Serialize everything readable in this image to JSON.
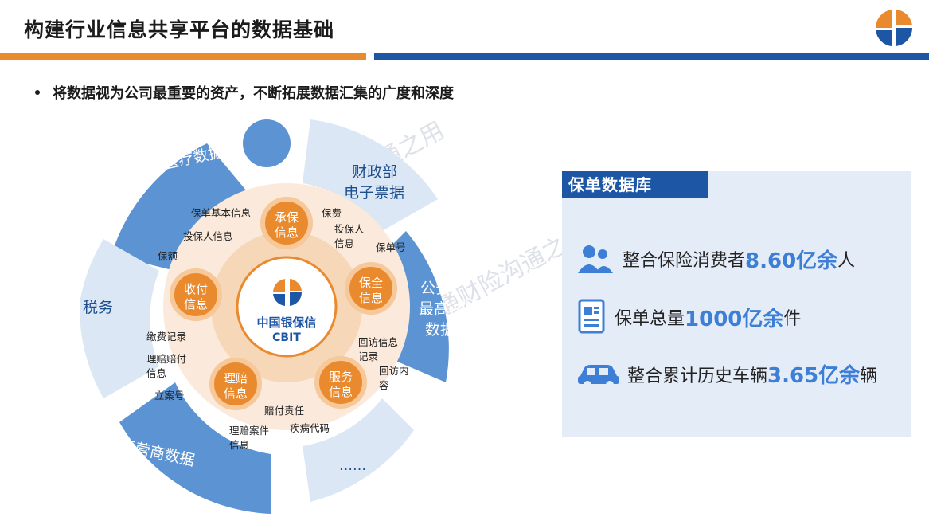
{
  "header": {
    "title": "构建行业信息共享平台的数据基础"
  },
  "bullet": {
    "text": "将数据视为公司最重要的资产，不断拓展数据汇集的广度和深度"
  },
  "center": {
    "logo_cn": "中国银保信",
    "logo_en": "CBIT"
  },
  "outer_ring": {
    "medical": "外部医疗数据",
    "finance_line1": "财政部",
    "finance_line2": "电子票据",
    "police_line1": "公安、",
    "police_line2": "最高法",
    "police_line3": "数据",
    "more": "……",
    "telecom": "运营商数据",
    "tax": "税务"
  },
  "nodes": {
    "underwriting": [
      "承保",
      "信息"
    ],
    "preservation": [
      "保全",
      "信息"
    ],
    "service": [
      "服务",
      "信息"
    ],
    "claims": [
      "理赔",
      "信息"
    ],
    "collection": [
      "收付",
      "信息"
    ]
  },
  "labels": {
    "policy_basic": "保单基本信息",
    "insured_info": "投保人信息",
    "premium": "保费",
    "policyholder_info_1": "投保人",
    "policyholder_info_2": "信息",
    "policy_no": "保单号",
    "amount": "保额",
    "payment_record": "缴费记录",
    "claim_payment_1": "理赔赔付",
    "claim_payment_2": "信息",
    "case_no": "立案号",
    "visit_record_1": "回访信息",
    "visit_record_2": "记录",
    "visit_content_1": "回访内",
    "visit_content_2": "容",
    "liability": "赔付责任",
    "disease_code": "疾病代码",
    "claim_case_1": "理赔案件",
    "claim_case_2": "信息"
  },
  "database": {
    "title": "保单数据库",
    "row1_prefix": "整合保险消费者",
    "row1_value": "8.60亿余",
    "row1_suffix": "人",
    "row2_prefix": "保单总量",
    "row2_value": "1000亿余",
    "row2_suffix": "件",
    "row3_prefix": "整合累计历史车辆",
    "row3_value": "3.65亿余",
    "row3_suffix": "辆"
  },
  "colors": {
    "orange": "#ea8a2e",
    "blue": "#1e56a6",
    "puzzle_dark": "#5b93d3",
    "puzzle_light": "#dbe7f5",
    "highlight": "#3d7ed6"
  }
}
